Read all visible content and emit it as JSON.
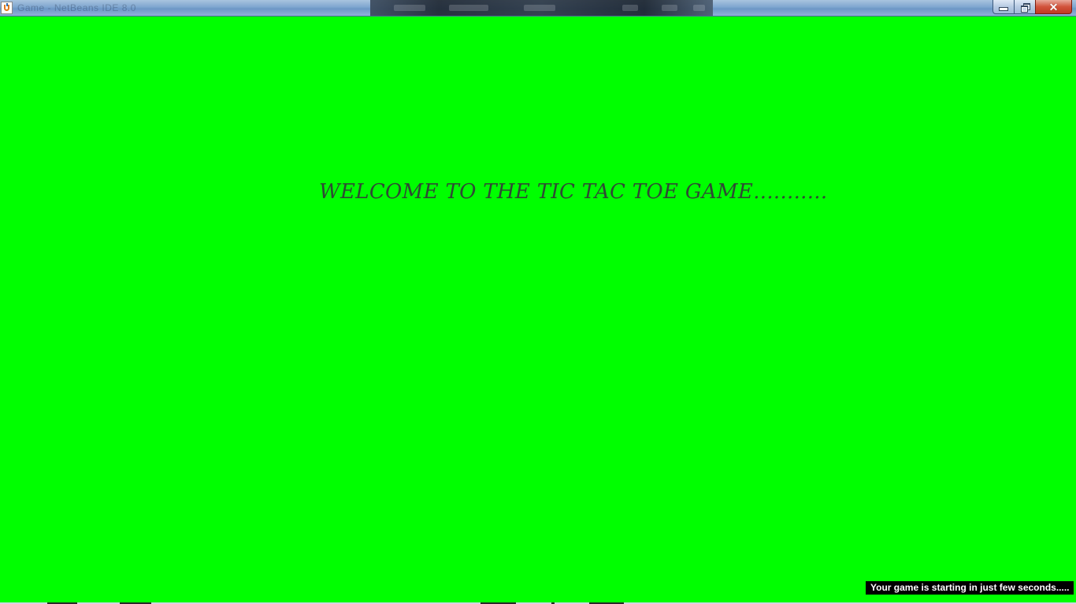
{
  "window": {
    "title": "Game - NetBeans IDE 8.0",
    "controls": {
      "minimize_icon": "minimize-icon",
      "maximize_icon": "restore-icon",
      "close_icon": "close-icon",
      "close_glyph": "✕"
    }
  },
  "main": {
    "welcome_text": "WELCOME TO THE TIC TAC TOE GAME...........",
    "status_text": "Your game is starting in just few seconds....."
  },
  "colors": {
    "background": "#00ff00",
    "welcome_text": "#2f4a34",
    "status_bg": "#000000",
    "status_text": "#ffffff"
  }
}
